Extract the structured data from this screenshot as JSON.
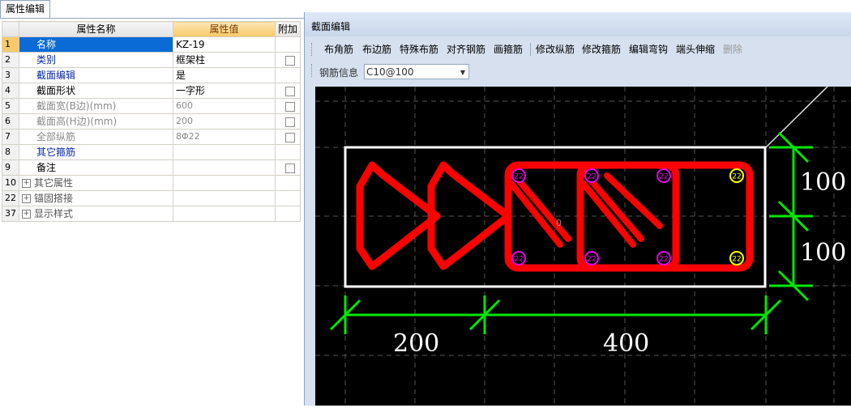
{
  "left_panel": {
    "tab_label": "属性编辑",
    "headers": {
      "name": "属性名称",
      "value": "属性值",
      "extra": "附加"
    },
    "rows": [
      {
        "num": "1",
        "name": "名称",
        "value": "KZ-19",
        "check": false,
        "style": "selected"
      },
      {
        "num": "2",
        "name": "类别",
        "value": "框架柱",
        "check": true,
        "style": "blue"
      },
      {
        "num": "3",
        "name": "截面编辑",
        "value": "是",
        "check": false,
        "style": "blue"
      },
      {
        "num": "4",
        "name": "截面形状",
        "value": "一字形",
        "check": true,
        "style": "normal"
      },
      {
        "num": "5",
        "name": "截面宽(B边)(mm)",
        "value": "600",
        "check": true,
        "style": "gray"
      },
      {
        "num": "6",
        "name": "截面高(H边)(mm)",
        "value": "200",
        "check": true,
        "style": "gray"
      },
      {
        "num": "7",
        "name": "全部纵筋",
        "value": "8Φ22",
        "check": true,
        "style": "gray"
      },
      {
        "num": "8",
        "name": "其它箍筋",
        "value": "",
        "check": false,
        "style": "blue"
      },
      {
        "num": "9",
        "name": "备注",
        "value": "",
        "check": true,
        "style": "normal"
      },
      {
        "num": "10",
        "name": "其它属性",
        "value": "",
        "check": false,
        "style": "group"
      },
      {
        "num": "22",
        "name": "锚固搭接",
        "value": "",
        "check": false,
        "style": "group"
      },
      {
        "num": "37",
        "name": "显示样式",
        "value": "",
        "check": false,
        "style": "group"
      }
    ]
  },
  "section_window": {
    "title": "截面编辑",
    "toolbar": [
      "布角筋",
      "布边筋",
      "特殊布筋",
      "对齐钢筋",
      "画箍筋",
      "修改纵筋",
      "修改箍筋",
      "编辑弯钩",
      "端头伸缩",
      "删除"
    ],
    "rebar_info_label": "钢筋信息",
    "rebar_info_value": "C10@100"
  },
  "drawing": {
    "dimensions": {
      "height_top": "100",
      "height_bottom": "100",
      "width_left": "200",
      "width_right": "400"
    },
    "bar_label": "22",
    "center_label": "0",
    "colors": {
      "background": "#000000",
      "outline": "#ffffff",
      "rebar": "#ff0000",
      "dimension": "#00e600",
      "grid": "#555555",
      "bar_magenta": "#e800e8",
      "bar_yellow": "#ffff00"
    }
  }
}
